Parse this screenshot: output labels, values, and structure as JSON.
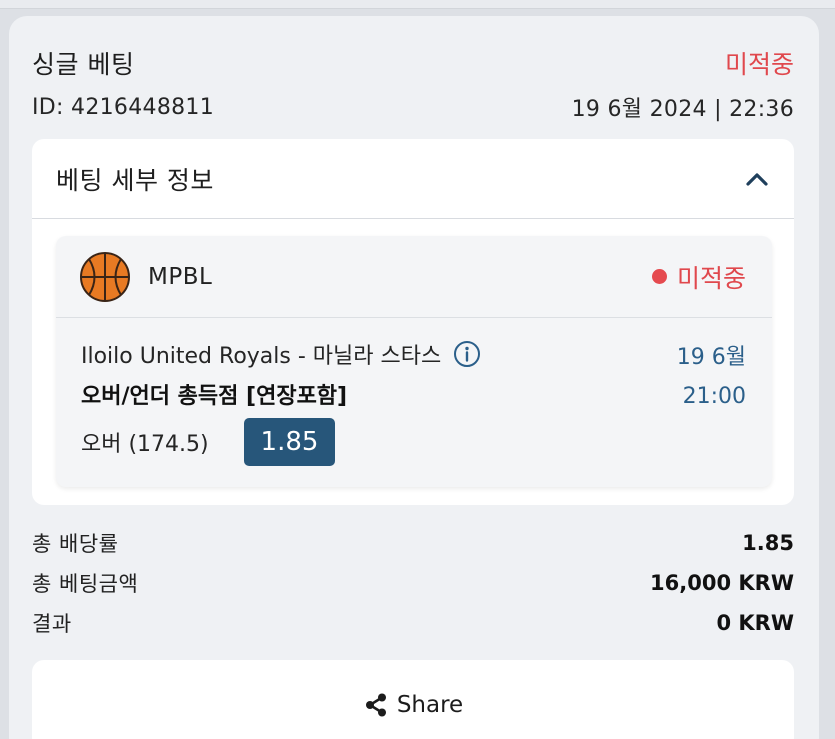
{
  "bet": {
    "type": "싱글 베팅",
    "status": "미적중",
    "id": "ID: 4216448811",
    "datetime": "19 6월 2024 | 22:36"
  },
  "details": {
    "title": "베팅 세부 정보",
    "collapse_icon": "chevron-up-icon"
  },
  "selection": {
    "sport_icon": "basketball-icon",
    "league": "MPBL",
    "status": "미적중",
    "match": "Iloilo United Royals - 마닐라 스타스",
    "market": "오버/언더 총득점 [연장포함]",
    "pick": "오버 (174.5)",
    "odds": "1.85",
    "date": "19 6월",
    "time": "21:00"
  },
  "summary": {
    "total_odds_label": "총 배당률",
    "total_odds": "1.85",
    "stake_label": "총 베팅금액",
    "stake": "16,000 KRW",
    "result_label": "결과",
    "result": "0 KRW"
  },
  "share": {
    "label": "Share",
    "icon": "share-icon"
  },
  "colors": {
    "loss_red": "#e0484d",
    "odds_blue": "#27567a",
    "date_blue": "#2b5f8a",
    "basketball_orange": "#e87a23"
  }
}
